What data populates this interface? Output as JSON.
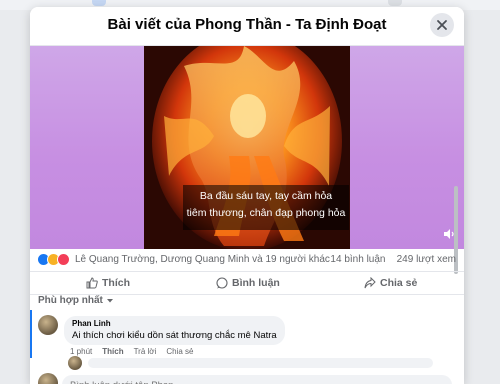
{
  "modal": {
    "title": "Bài viết của Phong Thần - Ta Định Đoạt"
  },
  "video": {
    "subtitle_line1": "Ba đầu sáu tay, tay cầm hỏa",
    "subtitle_line2": "tiêm thương, chân đạp phong hỏa"
  },
  "reactions": {
    "icons": [
      "like-icon",
      "haha-icon",
      "love-icon"
    ],
    "reactors_text": "Lê Quang Trường, Dương Quang Minh và 19 người khác",
    "comments_count": "14 bình luận",
    "views_count": "249 lượt xem"
  },
  "actions": {
    "like": "Thích",
    "comment": "Bình luận",
    "share": "Chia sẻ"
  },
  "sort": {
    "label": "Phù hợp nhất"
  },
  "comment": {
    "author": "Phan Linh",
    "text": "Ai thích chơi kiểu dồn sát thương chắc mê Natra",
    "time": "1 phút",
    "like": "Thích",
    "reply": "Trả lời",
    "share": "Chia sẻ"
  },
  "comment_input": {
    "placeholder": "Bình luận dưới tên Phan"
  },
  "colors": {
    "accent": "#1877f2",
    "video_bg": "#c78fe2",
    "like": "#1877f2",
    "haha": "#f7b125",
    "love": "#f33e58"
  }
}
